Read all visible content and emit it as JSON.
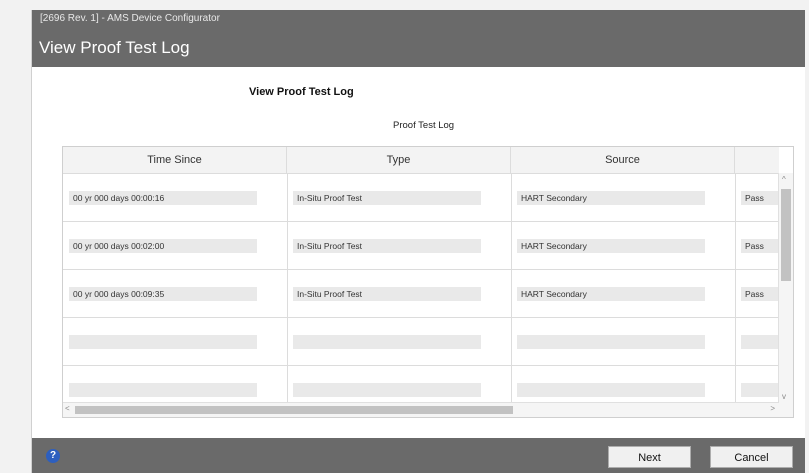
{
  "window": {
    "app_title": "[2696 Rev. 1] - AMS Device Configurator",
    "view_title": "View Proof Test Log"
  },
  "section": {
    "heading": "View Proof Test Log",
    "log_caption": "Proof Test Log"
  },
  "table": {
    "headers": [
      "Time Since",
      "Type",
      "Source",
      ""
    ],
    "rows": [
      [
        "00 yr 000 days 00:00:16",
        "In-Situ Proof Test",
        "HART Secondary",
        "Pass"
      ],
      [
        "00 yr 000 days 00:02:00",
        "In-Situ Proof Test",
        "HART Secondary",
        "Pass"
      ],
      [
        "00 yr 000 days 00:09:35",
        "In-Situ Proof Test",
        "HART Secondary",
        "Pass"
      ],
      [
        "",
        "",
        "",
        ""
      ],
      [
        "",
        "",
        "",
        ""
      ]
    ]
  },
  "footer": {
    "next_label": "Next",
    "cancel_label": "Cancel",
    "help_glyph": "?"
  },
  "icons": {
    "help": "help-icon",
    "scroll_up": "chevron-up-icon",
    "scroll_down": "chevron-down-icon",
    "scroll_left": "chevron-left-icon",
    "scroll_right": "chevron-right-icon"
  },
  "colors": {
    "titlebar": "#6a6a6a",
    "help_icon": "#2d5fbf"
  }
}
